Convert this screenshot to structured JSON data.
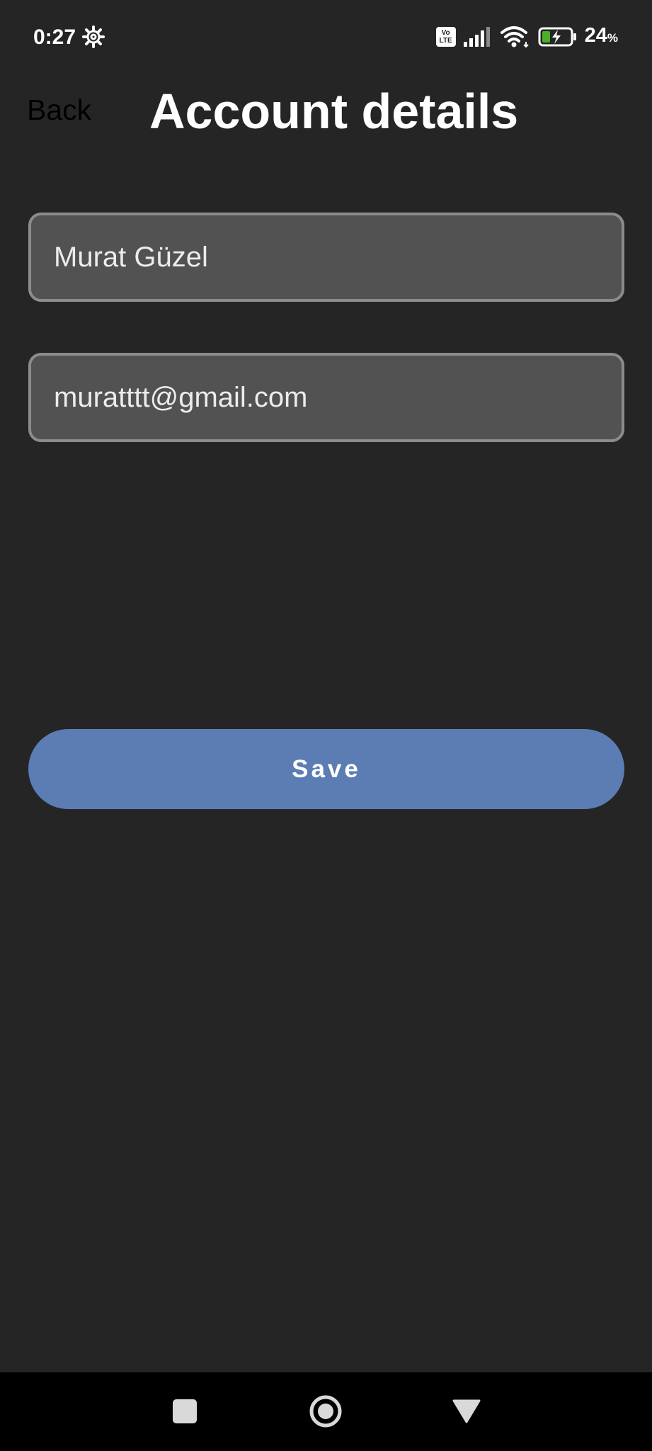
{
  "status_bar": {
    "time": "0:27",
    "volte_top": "Vo",
    "volte_bottom": "LTE",
    "battery_value": "24",
    "battery_unit": "%",
    "icons": [
      "gear-icon",
      "volte-icon",
      "signal-icon",
      "wifi-icon",
      "battery-charging-icon"
    ]
  },
  "header": {
    "back_label": "Back",
    "title": "Account details"
  },
  "form": {
    "name_value": "Murat Güzel",
    "email_value": "muratttt@gmail.com",
    "save_label": "Save"
  },
  "nav_bar": {
    "icons": [
      "recents-square-icon",
      "home-circle-icon",
      "back-triangle-icon"
    ]
  },
  "colors": {
    "background": "#252525",
    "field_background": "#525252",
    "field_border": "#8c8c8c",
    "accent": "#5b7db4",
    "battery_fill": "#4caf2a"
  }
}
